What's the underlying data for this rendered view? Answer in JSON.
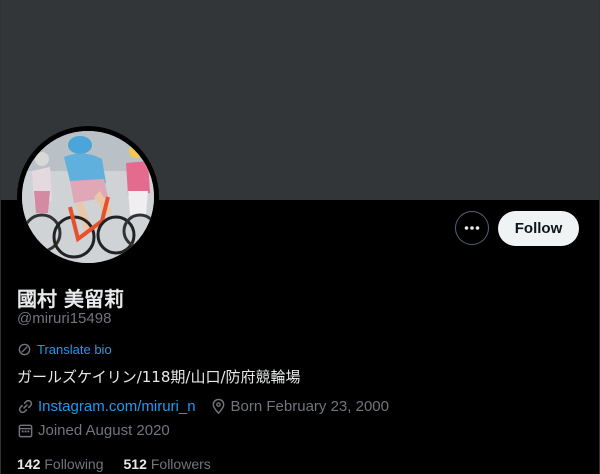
{
  "profile": {
    "display_name": "國村 美留莉",
    "handle": "@miruri15498",
    "translate_label": "Translate bio",
    "bio": "ガールズケイリン/118期/山口/防府競輪場",
    "link": "Instagram.com/miruri_n",
    "birthday": "Born February 23, 2000",
    "joined": "Joined August 2020"
  },
  "actions": {
    "follow_label": "Follow",
    "more_icon": "more-horizontal-icon"
  },
  "stats": {
    "following_count": "142",
    "following_label": "Following",
    "followers_count": "512",
    "followers_label": "Followers"
  },
  "colors": {
    "background": "#000000",
    "banner": "#333639",
    "accent": "#1d9bf0",
    "muted": "#71767b",
    "text": "#e7e9ea"
  }
}
